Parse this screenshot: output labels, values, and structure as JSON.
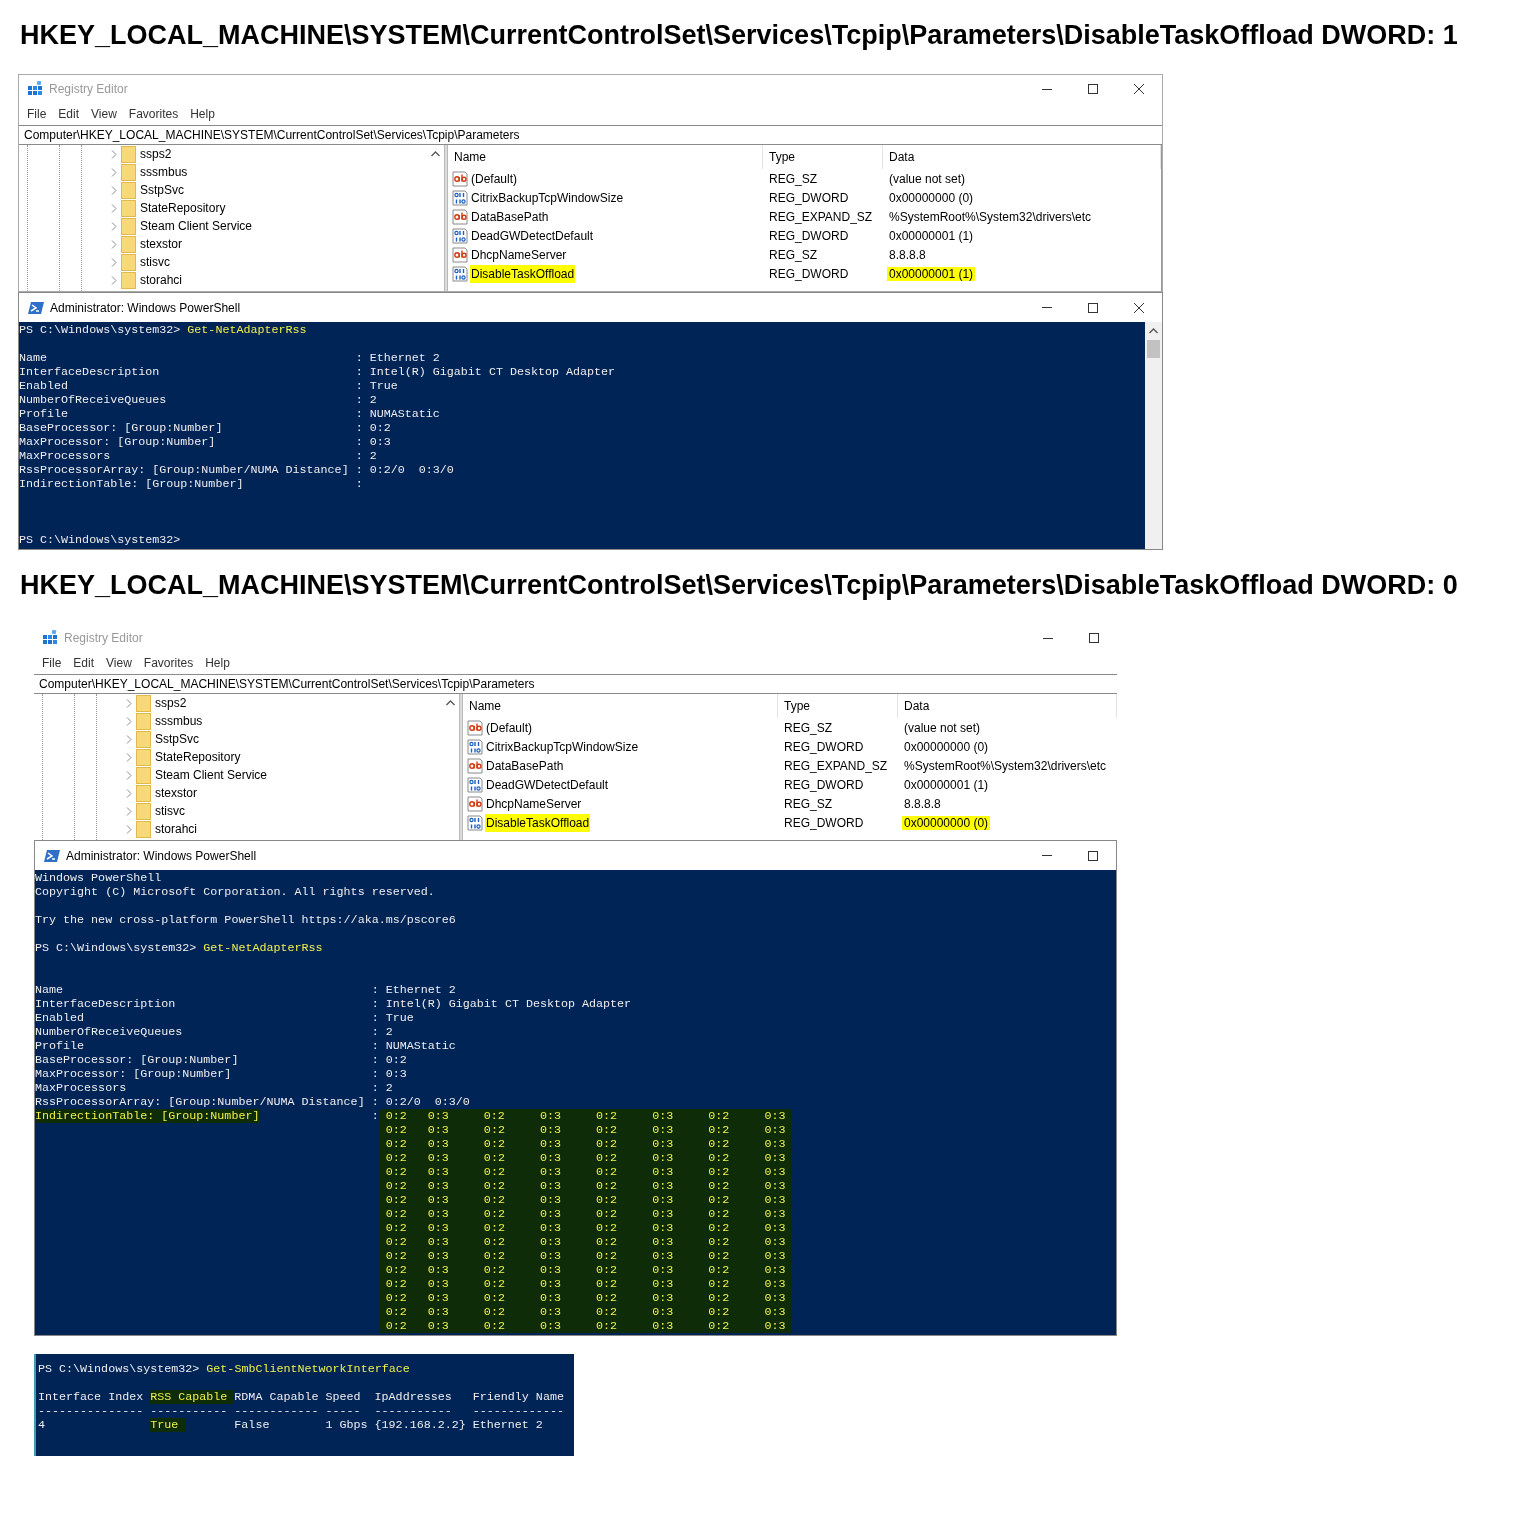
{
  "sections": [
    {
      "heading": "HKEY_LOCAL_MACHINE\\SYSTEM\\CurrentControlSet\\Services\\Tcpip\\Parameters\\DisableTaskOffload DWORD: 1",
      "registry": {
        "title": "Registry Editor",
        "close_button_visible": true,
        "menu": [
          "File",
          "Edit",
          "View",
          "Favorites",
          "Help"
        ],
        "address": "Computer\\HKEY_LOCAL_MACHINE\\SYSTEM\\CurrentControlSet\\Services\\Tcpip\\Parameters",
        "tree": [
          {
            "name": "ssps2",
            "expanded": false
          },
          {
            "name": "sssmbus",
            "expanded": false
          },
          {
            "name": "SstpSvc",
            "expanded": false
          },
          {
            "name": "StateRepository",
            "expanded": false
          },
          {
            "name": "Steam Client Service",
            "expanded": false
          },
          {
            "name": "stexstor",
            "expanded": false
          },
          {
            "name": "stisvc",
            "expanded": false
          },
          {
            "name": "storahci",
            "expanded": false
          }
        ],
        "columns": [
          "Name",
          "Type",
          "Data"
        ],
        "values": [
          {
            "kind": "string",
            "name": "(Default)",
            "type": "REG_SZ",
            "data": "(value not set)",
            "highlighted": false
          },
          {
            "kind": "binary",
            "name": "CitrixBackupTcpWindowSize",
            "type": "REG_DWORD",
            "data": "0x00000000 (0)",
            "highlighted": false
          },
          {
            "kind": "string",
            "name": "DataBasePath",
            "type": "REG_EXPAND_SZ",
            "data": "%SystemRoot%\\System32\\drivers\\etc",
            "highlighted": false
          },
          {
            "kind": "binary",
            "name": "DeadGWDetectDefault",
            "type": "REG_DWORD",
            "data": "0x00000001 (1)",
            "highlighted": false
          },
          {
            "kind": "string",
            "name": "DhcpNameServer",
            "type": "REG_SZ",
            "data": "8.8.8.8",
            "highlighted": false
          },
          {
            "kind": "binary",
            "name": "DisableTaskOffload",
            "type": "REG_DWORD",
            "data": "0x00000001 (1)",
            "highlighted": true
          }
        ]
      },
      "powershell": {
        "title": "Administrator: Windows PowerShell",
        "close_button_visible": true,
        "scrollbar_visible": true,
        "lines": [
          {
            "kind": "command",
            "prompt": "PS C:\\Windows\\system32>",
            "command": "Get-NetAdapterRss"
          },
          {
            "kind": "blank"
          },
          {
            "kind": "property",
            "label": "Name",
            "separator": ":",
            "value": "Ethernet 2",
            "marked": false
          },
          {
            "kind": "property",
            "label": "InterfaceDescription",
            "separator": ":",
            "value": "Intel(R) Gigabit CT Desktop Adapter",
            "marked": false
          },
          {
            "kind": "property",
            "label": "Enabled",
            "separator": ":",
            "value": "True",
            "marked": false
          },
          {
            "kind": "property",
            "label": "NumberOfReceiveQueues",
            "separator": ":",
            "value": "2",
            "marked": false
          },
          {
            "kind": "property",
            "label": "Profile",
            "separator": ":",
            "value": "NUMAStatic",
            "marked": false
          },
          {
            "kind": "property",
            "label": "BaseProcessor: [Group:Number]",
            "separator": ":",
            "value": "0:2",
            "marked": false
          },
          {
            "kind": "property",
            "label": "MaxProcessor: [Group:Number]",
            "separator": ":",
            "value": "0:3",
            "marked": false
          },
          {
            "kind": "property",
            "label": "MaxProcessors",
            "separator": ":",
            "value": "2",
            "marked": false
          },
          {
            "kind": "property",
            "label": "RssProcessorArray: [Group:Number/NUMA Distance]",
            "separator": ":",
            "value": "0:2/0  0:3/0",
            "marked": false
          },
          {
            "kind": "property",
            "label": "IndirectionTable: [Group:Number]",
            "separator": ":",
            "marked": false
          },
          {
            "kind": "blank"
          },
          {
            "kind": "blank"
          },
          {
            "kind": "blank"
          },
          {
            "kind": "command",
            "prompt": "PS C:\\Windows\\system32>"
          }
        ]
      }
    },
    {
      "heading": "HKEY_LOCAL_MACHINE\\SYSTEM\\CurrentControlSet\\Services\\Tcpip\\Parameters\\DisableTaskOffload DWORD: 0",
      "registry": {
        "title": "Registry Editor",
        "close_button_visible": false,
        "menu": [
          "File",
          "Edit",
          "View",
          "Favorites",
          "Help"
        ],
        "address": "Computer\\HKEY_LOCAL_MACHINE\\SYSTEM\\CurrentControlSet\\Services\\Tcpip\\Parameters",
        "tree": [
          {
            "name": "ssps2",
            "expanded": false
          },
          {
            "name": "sssmbus",
            "expanded": false
          },
          {
            "name": "SstpSvc",
            "expanded": false
          },
          {
            "name": "StateRepository",
            "expanded": false
          },
          {
            "name": "Steam Client Service",
            "expanded": false
          },
          {
            "name": "stexstor",
            "expanded": false
          },
          {
            "name": "stisvc",
            "expanded": false
          },
          {
            "name": "storahci",
            "expanded": false
          }
        ],
        "columns": [
          "Name",
          "Type",
          "Data"
        ],
        "values": [
          {
            "kind": "string",
            "name": "(Default)",
            "type": "REG_SZ",
            "data": "(value not set)",
            "highlighted": false
          },
          {
            "kind": "binary",
            "name": "CitrixBackupTcpWindowSize",
            "type": "REG_DWORD",
            "data": "0x00000000 (0)",
            "highlighted": false
          },
          {
            "kind": "string",
            "name": "DataBasePath",
            "type": "REG_EXPAND_SZ",
            "data": "%SystemRoot%\\System32\\drivers\\etc",
            "highlighted": false
          },
          {
            "kind": "binary",
            "name": "DeadGWDetectDefault",
            "type": "REG_DWORD",
            "data": "0x00000001 (1)",
            "highlighted": false
          },
          {
            "kind": "string",
            "name": "DhcpNameServer",
            "type": "REG_SZ",
            "data": "8.8.8.8",
            "highlighted": false
          },
          {
            "kind": "binary",
            "name": "DisableTaskOffload",
            "type": "REG_DWORD",
            "data": "0x00000000 (0)",
            "highlighted": true
          }
        ]
      },
      "powershell": {
        "title": "Administrator: Windows PowerShell",
        "close_button_visible": false,
        "scrollbar_visible": false,
        "lines": [
          {
            "kind": "text",
            "text": "Windows PowerShell"
          },
          {
            "kind": "text",
            "text": "Copyright (C) Microsoft Corporation. All rights reserved."
          },
          {
            "kind": "blank"
          },
          {
            "kind": "text",
            "text": "Try the new cross-platform PowerShell https://aka.ms/pscore6"
          },
          {
            "kind": "blank"
          },
          {
            "kind": "command",
            "prompt": "PS C:\\Windows\\system32>",
            "command": "Get-NetAdapterRss"
          },
          {
            "kind": "blank"
          },
          {
            "kind": "blank"
          },
          {
            "kind": "property",
            "label": "Name",
            "separator": ":",
            "value": "Ethernet 2",
            "marked": false
          },
          {
            "kind": "property",
            "label": "InterfaceDescription",
            "separator": ":",
            "value": "Intel(R) Gigabit CT Desktop Adapter",
            "marked": false
          },
          {
            "kind": "property",
            "label": "Enabled",
            "separator": ":",
            "value": "True",
            "marked": false
          },
          {
            "kind": "property",
            "label": "NumberOfReceiveQueues",
            "separator": ":",
            "value": "2",
            "marked": false
          },
          {
            "kind": "property",
            "label": "Profile",
            "separator": ":",
            "value": "NUMAStatic",
            "marked": false
          },
          {
            "kind": "property",
            "label": "BaseProcessor: [Group:Number]",
            "separator": ":",
            "value": "0:2",
            "marked": false
          },
          {
            "kind": "property",
            "label": "MaxProcessor: [Group:Number]",
            "separator": ":",
            "value": "0:3",
            "marked": false
          },
          {
            "kind": "property",
            "label": "MaxProcessors",
            "separator": ":",
            "value": "2",
            "marked": false
          },
          {
            "kind": "property",
            "label": "RssProcessorArray: [Group:Number/NUMA Distance]",
            "separator": ":",
            "value": "0:2/0  0:3/0",
            "marked": false
          },
          {
            "kind": "property",
            "label": "IndirectionTable: [Group:Number]",
            "separator": ":",
            "value": "0:2   0:3     0:2     0:3     0:2     0:3     0:2     0:3",
            "marked": true
          },
          {
            "kind": "continuation",
            "value": "0:2   0:3     0:2     0:3     0:2     0:3     0:2     0:3",
            "marked": true
          },
          {
            "kind": "continuation",
            "value": "0:2   0:3     0:2     0:3     0:2     0:3     0:2     0:3",
            "marked": true
          },
          {
            "kind": "continuation",
            "value": "0:2   0:3     0:2     0:3     0:2     0:3     0:2     0:3",
            "marked": true
          },
          {
            "kind": "continuation",
            "value": "0:2   0:3     0:2     0:3     0:2     0:3     0:2     0:3",
            "marked": true
          },
          {
            "kind": "continuation",
            "value": "0:2   0:3     0:2     0:3     0:2     0:3     0:2     0:3",
            "marked": true
          },
          {
            "kind": "continuation",
            "value": "0:2   0:3     0:2     0:3     0:2     0:3     0:2     0:3",
            "marked": true
          },
          {
            "kind": "continuation",
            "value": "0:2   0:3     0:2     0:3     0:2     0:3     0:2     0:3",
            "marked": true
          },
          {
            "kind": "continuation",
            "value": "0:2   0:3     0:2     0:3     0:2     0:3     0:2     0:3",
            "marked": true
          },
          {
            "kind": "continuation",
            "value": "0:2   0:3     0:2     0:3     0:2     0:3     0:2     0:3",
            "marked": true
          },
          {
            "kind": "continuation",
            "value": "0:2   0:3     0:2     0:3     0:2     0:3     0:2     0:3",
            "marked": true
          },
          {
            "kind": "continuation",
            "value": "0:2   0:3     0:2     0:3     0:2     0:3     0:2     0:3",
            "marked": true
          },
          {
            "kind": "continuation",
            "value": "0:2   0:3     0:2     0:3     0:2     0:3     0:2     0:3",
            "marked": true
          },
          {
            "kind": "continuation",
            "value": "0:2   0:3     0:2     0:3     0:2     0:3     0:2     0:3",
            "marked": true
          },
          {
            "kind": "continuation",
            "value": "0:2   0:3     0:2     0:3     0:2     0:3     0:2     0:3",
            "marked": true
          },
          {
            "kind": "continuation",
            "value": "0:2   0:3     0:2     0:3     0:2     0:3     0:2     0:3",
            "marked": true
          }
        ]
      }
    }
  ],
  "smb_console": {
    "lines": [
      {
        "kind": "command",
        "prompt": "PS C:\\Windows\\system32>",
        "command": "Get-SmbClientNetworkInterface"
      },
      {
        "kind": "blank"
      }
    ],
    "columns": [
      {
        "header": "Interface Index",
        "rule": "---------------",
        "value": "4",
        "marked": false
      },
      {
        "header": "RSS Capable",
        "rule": "-----------",
        "value": "True",
        "marked": true
      },
      {
        "header": "RDMA Capable",
        "rule": "------------",
        "value": "False",
        "marked": false
      },
      {
        "header": "Speed",
        "rule": "-----",
        "value": "1 Gbps",
        "marked": false
      },
      {
        "header": "IpAddresses",
        "rule": "-----------",
        "value": "{192.168.2.2}",
        "marked": false
      },
      {
        "header": "Friendly Name",
        "rule": "-------------",
        "value": "Ethernet 2",
        "marked": false
      }
    ]
  }
}
